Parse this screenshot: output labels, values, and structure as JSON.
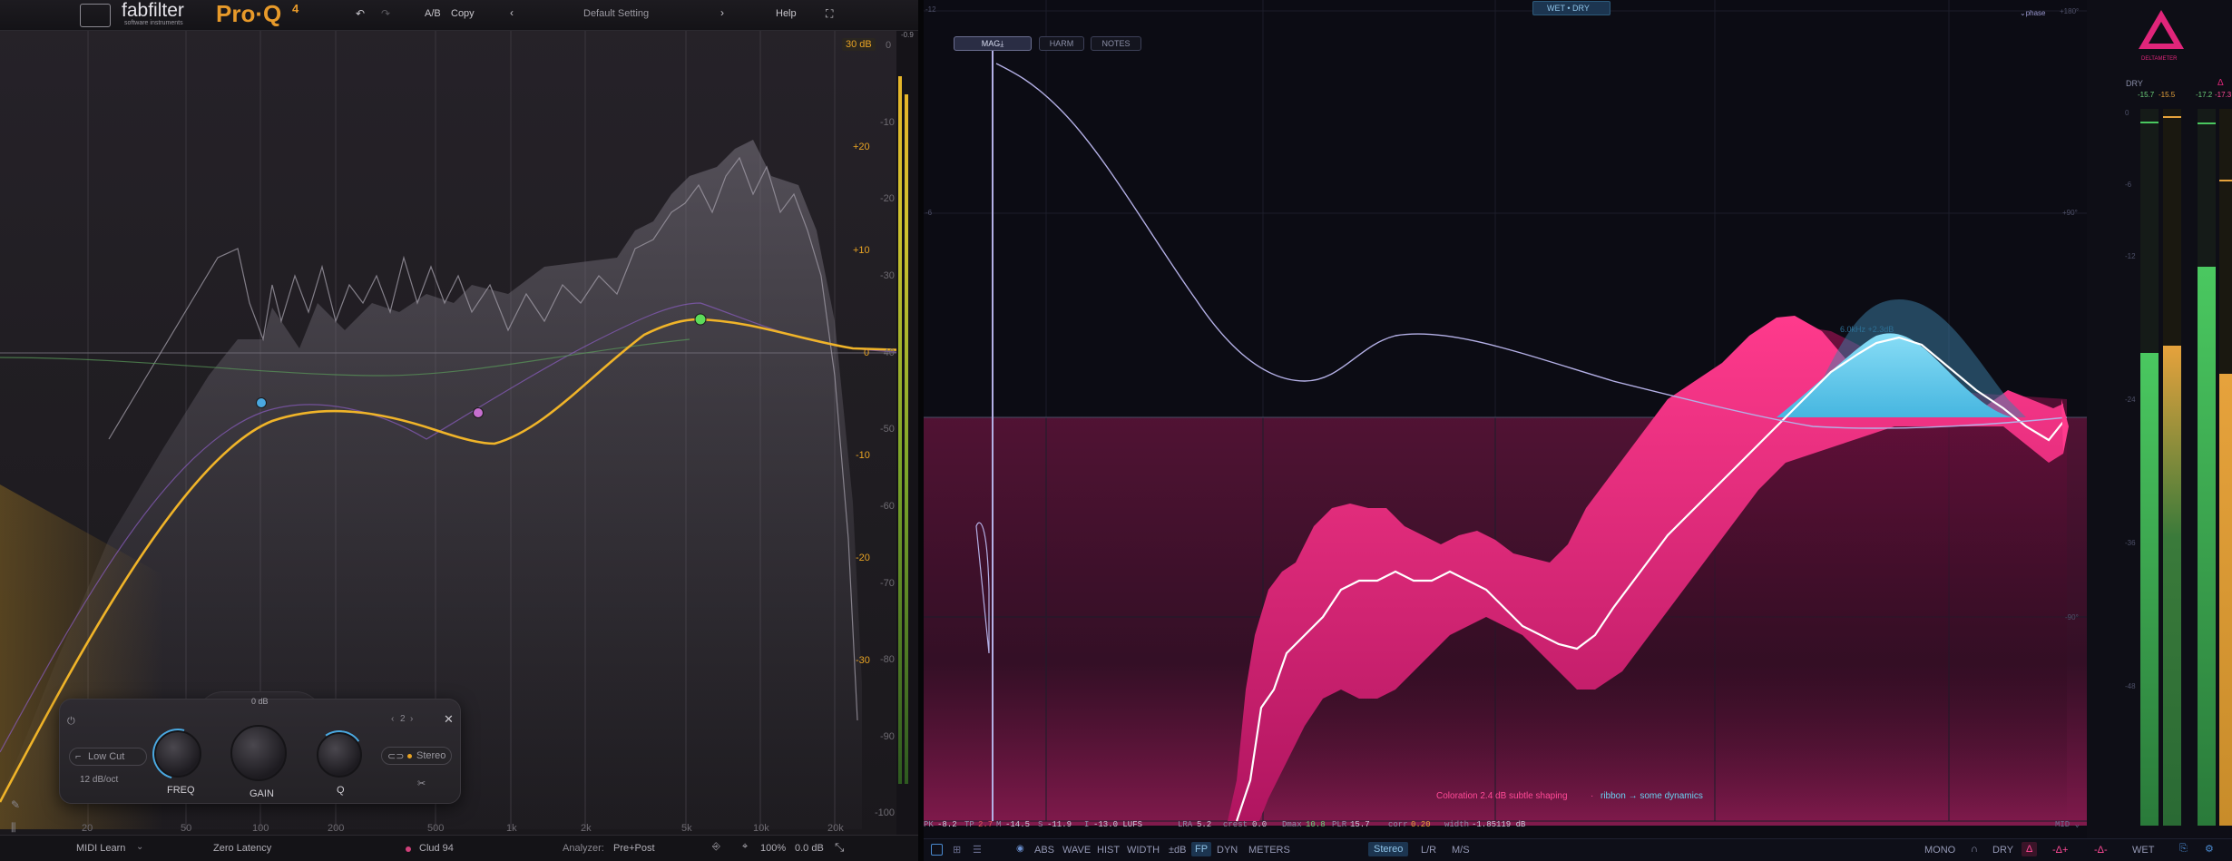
{
  "left": {
    "logo_brand": "fabfilter",
    "logo_sub": "software instruments",
    "logo_product": "Pro·Q",
    "logo_version": "4",
    "undo_icon": "undo-icon",
    "redo_icon": "redo-icon",
    "ab_label": "A/B",
    "copy_label": "Copy",
    "preset_name": "Default Setting",
    "help_label": "Help",
    "range_label": "30 dB",
    "gain_scale": [
      "+20",
      "+10",
      "0",
      "-10",
      "-20",
      "-30"
    ],
    "analyzer_scale": [
      "0",
      "-10",
      "-20",
      "-30",
      "-40",
      "-50",
      "-60",
      "-70",
      "-80",
      "-90",
      "-100"
    ],
    "meter_peak": "-0.9",
    "freq_labels": [
      "20",
      "50",
      "100",
      "200",
      "500",
      "1k",
      "2k",
      "5k",
      "10k",
      "20k"
    ],
    "band_panel": {
      "gain_value": "0 dB",
      "shape_label": "Low Cut",
      "slope_label": "12 dB/oct",
      "freq_label": "FREQ",
      "gain_label": "GAIN",
      "q_label": "Q",
      "band_number": "2",
      "stereo_label": "Stereo"
    },
    "bottom": {
      "midi_learn": "MIDI Learn",
      "latency": "Zero Latency",
      "instance": "Clud 94",
      "analyzer_label": "Analyzer:",
      "analyzer_value": "Pre+Post",
      "zoom": "100%",
      "output_gain": "0.0 dB"
    },
    "colors": {
      "curve": "#f0b429",
      "band1": "#4aa8e0",
      "band2": "#c76fd0",
      "band3": "#5ddc5a"
    }
  },
  "right": {
    "wet_dry_label": "WET • DRY",
    "tabs": [
      "MAG⤓",
      "HARM",
      "NOTES"
    ],
    "phase_label": "⌄phase",
    "phase_scale": [
      "+180°",
      "+90°",
      "-90°"
    ],
    "db_grid": [
      "-12",
      "-6"
    ],
    "peak_annotation": "6.0kHz +2.3dB",
    "coloration_text": "Coloration 2.4 dB  subtle shaping",
    "ribbon_text": "ribbon → some dynamics",
    "stats": {
      "pk_label": "PK",
      "pk": "-8.2",
      "tp_label": "TP",
      "tp": "2.7",
      "m_label": "M",
      "m": "-14.5",
      "s_label": "S",
      "s": "-11.9",
      "i_label": "I",
      "i": "-13.0 LUFS",
      "lra_label": "LRA",
      "lra": "5.2",
      "crest_label": "crest",
      "crest": "0.0",
      "dmax_label": "Dmax",
      "dmax": "10.8",
      "plr_label": "PLR",
      "plr": "15.7",
      "corr_label": "corr",
      "corr": "0.20",
      "width_label": "width",
      "width": "-1.85119 dB"
    },
    "mid_label": "MID ⌄",
    "toolbar": [
      "ABS",
      "WAVE",
      "HIST",
      "WIDTH",
      "±dB",
      "FP",
      "DYN",
      "METERS"
    ],
    "mode_buttons": [
      "Stereo",
      "L/R",
      "M/S"
    ],
    "right_buttons": {
      "mono": "MONO",
      "dry": "DRY",
      "delta": "Δ",
      "delta_plus": "-Δ+",
      "delta_minus": "-Δ-",
      "wet": "WET"
    },
    "logo_name": "DELTAMETER",
    "meters": {
      "dry_label": "DRY",
      "delta_label": "Δ",
      "dry_values": [
        "-15.7",
        "-15.5"
      ],
      "wet_values": [
        "-17.2",
        "-17.3"
      ],
      "scale": [
        "0",
        "-6",
        "-12",
        "-24",
        "-36",
        "-48"
      ],
      "levels_dry": [
        0.66,
        0.67
      ],
      "levels_wet": [
        0.78,
        0.63
      ]
    },
    "colors": {
      "pink": "#e0257a",
      "cyan": "#5cc8ea",
      "phase": "#b4b0e6",
      "meter": "#3bbf55",
      "meter_orange": "#e6a23c"
    }
  }
}
